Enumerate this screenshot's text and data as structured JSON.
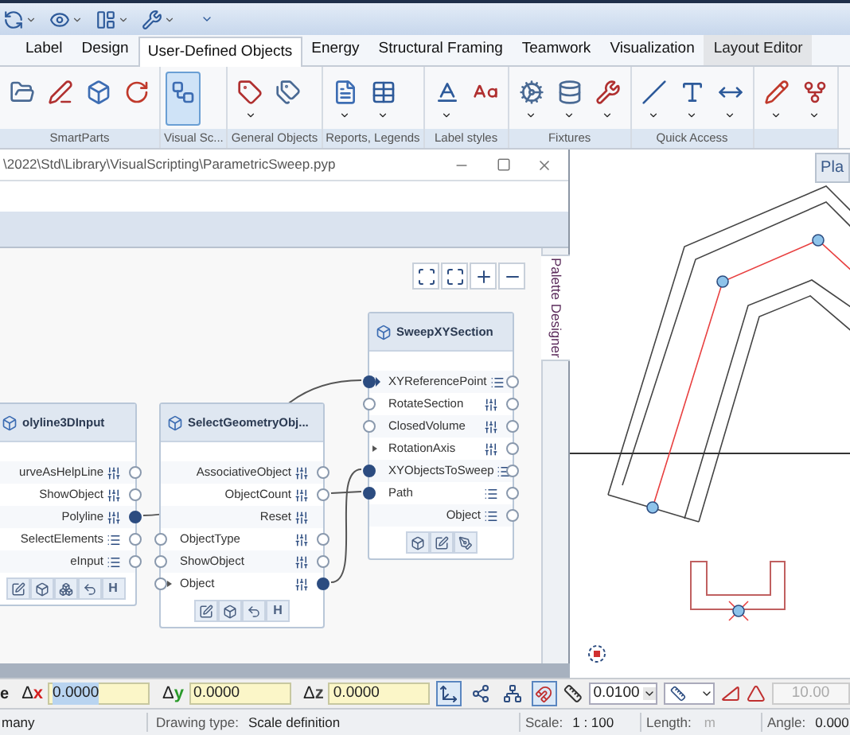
{
  "ribbon": {
    "tabs": [
      {
        "label": "Label",
        "selected": false,
        "contextual": false
      },
      {
        "label": "Design",
        "selected": false,
        "contextual": false
      },
      {
        "label": "User-Defined Objects",
        "selected": true,
        "contextual": false
      },
      {
        "label": "Energy",
        "selected": false,
        "contextual": false
      },
      {
        "label": "Structural Framing",
        "selected": false,
        "contextual": false
      },
      {
        "label": "Teamwork",
        "selected": false,
        "contextual": false
      },
      {
        "label": "Visualization",
        "selected": false,
        "contextual": false
      },
      {
        "label": "Layout Editor",
        "selected": false,
        "contextual": true
      }
    ],
    "groups": [
      {
        "label": "SmartParts",
        "buttons": [
          {
            "selected": false,
            "dropdown": false
          },
          {
            "selected": false,
            "dropdown": false
          },
          {
            "selected": false,
            "dropdown": false
          },
          {
            "selected": false,
            "dropdown": false
          }
        ]
      },
      {
        "label": "Visual Sc...",
        "buttons": [
          {
            "selected": true,
            "dropdown": false
          }
        ]
      },
      {
        "label": "General Objects",
        "buttons": [
          {
            "selected": false,
            "dropdown": true
          },
          {
            "selected": false,
            "dropdown": false
          }
        ]
      },
      {
        "label": "Reports, Legends",
        "buttons": [
          {
            "selected": false,
            "dropdown": true
          },
          {
            "selected": false,
            "dropdown": true
          }
        ]
      },
      {
        "label": "Label styles",
        "buttons": [
          {
            "selected": false,
            "dropdown": true
          },
          {
            "selected": false,
            "dropdown": false
          }
        ]
      },
      {
        "label": "Fixtures",
        "buttons": [
          {
            "selected": false,
            "dropdown": true
          },
          {
            "selected": false,
            "dropdown": true
          },
          {
            "selected": false,
            "dropdown": true
          }
        ]
      },
      {
        "label": "Quick Access",
        "buttons": [
          {
            "selected": false,
            "dropdown": true
          },
          {
            "selected": false,
            "dropdown": true
          },
          {
            "selected": false,
            "dropdown": true
          }
        ]
      },
      {
        "buttons": [
          {
            "selected": false,
            "dropdown": true
          },
          {
            "selected": false,
            "dropdown": true
          }
        ]
      }
    ]
  },
  "script_window": {
    "title": "\\2022\\Std\\Library\\VisualScripting\\ParametricSweep.pyp",
    "side_tab": "Palette Designer",
    "nodes": [
      {
        "title": "olyline3DInput",
        "rows": [
          {
            "label": "urveAsHelpLine",
            "kind": "param",
            "out_port": {
              "kind": "open"
            }
          },
          {
            "label": "ShowObject",
            "kind": "param",
            "out_port": {
              "kind": "open"
            }
          },
          {
            "label": "Polyline",
            "kind": "param",
            "out_port": {
              "kind": "filled"
            }
          },
          {
            "label": "SelectElements",
            "kind": "list",
            "out_port": {
              "kind": "open"
            }
          },
          {
            "label": "eInput",
            "kind": "list",
            "out_port": {
              "kind": "open"
            }
          }
        ],
        "footer": [
          {
            "kind": "edit"
          },
          {
            "kind": "cube"
          },
          {
            "kind": "cubes"
          },
          {
            "kind": "undo"
          },
          {
            "kind": "text",
            "label": "H"
          }
        ]
      },
      {
        "title": "SelectGeometryObj...",
        "rows": [
          {
            "label": "AssociativeObject",
            "kind": "param",
            "out_port": {
              "kind": "open"
            }
          },
          {
            "label": "ObjectCount",
            "kind": "param",
            "out_port": {
              "kind": "open"
            }
          },
          {
            "label": "Reset",
            "kind": "param"
          },
          {
            "label": "ObjectType",
            "kind": "param",
            "in_port": {
              "kind": "open"
            },
            "out_port": {
              "kind": "open"
            }
          },
          {
            "label": "ShowObject",
            "kind": "param",
            "in_port": {
              "kind": "open"
            },
            "out_port": {
              "kind": "open"
            }
          },
          {
            "label": "Object",
            "kind": "param",
            "in_port": {
              "kind": "open-arrow"
            },
            "out_port": {
              "kind": "filled"
            }
          }
        ],
        "footer": [
          {
            "kind": "edit"
          },
          {
            "kind": "cube"
          },
          {
            "kind": "undo"
          },
          {
            "kind": "text",
            "label": "H"
          }
        ]
      },
      {
        "title": "SweepXYSection",
        "rows": [
          {
            "label": "XYReferencePoint",
            "kind": "list",
            "in_port": {
              "kind": "filled-arrow"
            },
            "out_port": {
              "kind": "open"
            }
          },
          {
            "label": "RotateSection",
            "kind": "param",
            "in_port": {
              "kind": "open"
            },
            "out_port": {
              "kind": "open"
            }
          },
          {
            "label": "ClosedVolume",
            "kind": "param",
            "in_port": {
              "kind": "open"
            },
            "out_port": {
              "kind": "open"
            }
          },
          {
            "label": "RotationAxis",
            "kind": "param",
            "in_port": {
              "kind": "arrow"
            },
            "out_port": {
              "kind": "open"
            }
          },
          {
            "label": "XYObjectsToSweep",
            "kind": "list",
            "in_port": {
              "kind": "filled"
            },
            "out_port": {
              "kind": "open"
            }
          },
          {
            "label": "Path",
            "kind": "list",
            "in_port": {
              "kind": "filled"
            },
            "out_port": {
              "kind": "open"
            }
          },
          {
            "label": "Object",
            "kind": "list",
            "out_port": {
              "kind": "open"
            }
          }
        ],
        "footer": [
          {
            "kind": "cube"
          },
          {
            "kind": "edit"
          },
          {
            "kind": "pen"
          }
        ]
      }
    ]
  },
  "plan_tab": "Pla",
  "coordinate_bar": {
    "label": "e",
    "deltas": [
      {
        "symbol": "Δ",
        "axis": "x",
        "color": "#d42020",
        "value": "0.0000",
        "selected": true
      },
      {
        "symbol": "Δ",
        "axis": "y",
        "color": "#2a9a2a",
        "value": "0.0000",
        "selected": false
      },
      {
        "symbol": "Δ",
        "axis": "z",
        "color": "#444444",
        "value": "0.0000",
        "selected": false
      }
    ],
    "tools": [
      {
        "selected": true
      },
      {
        "selected": false
      },
      {
        "selected": false
      },
      {
        "selected": true
      }
    ],
    "step": "0.0100",
    "angle_field": {
      "value": "10.00",
      "disabled": true
    }
  },
  "status_bar": {
    "country": "many",
    "drawing_type_label": "Drawing type:",
    "drawing_type": "Scale definition",
    "scale_label": "Scale:",
    "scale": "1 : 100",
    "length_label": "Length:",
    "length_unit": "m",
    "angle_label": "Angle:",
    "angle": "0.000"
  }
}
